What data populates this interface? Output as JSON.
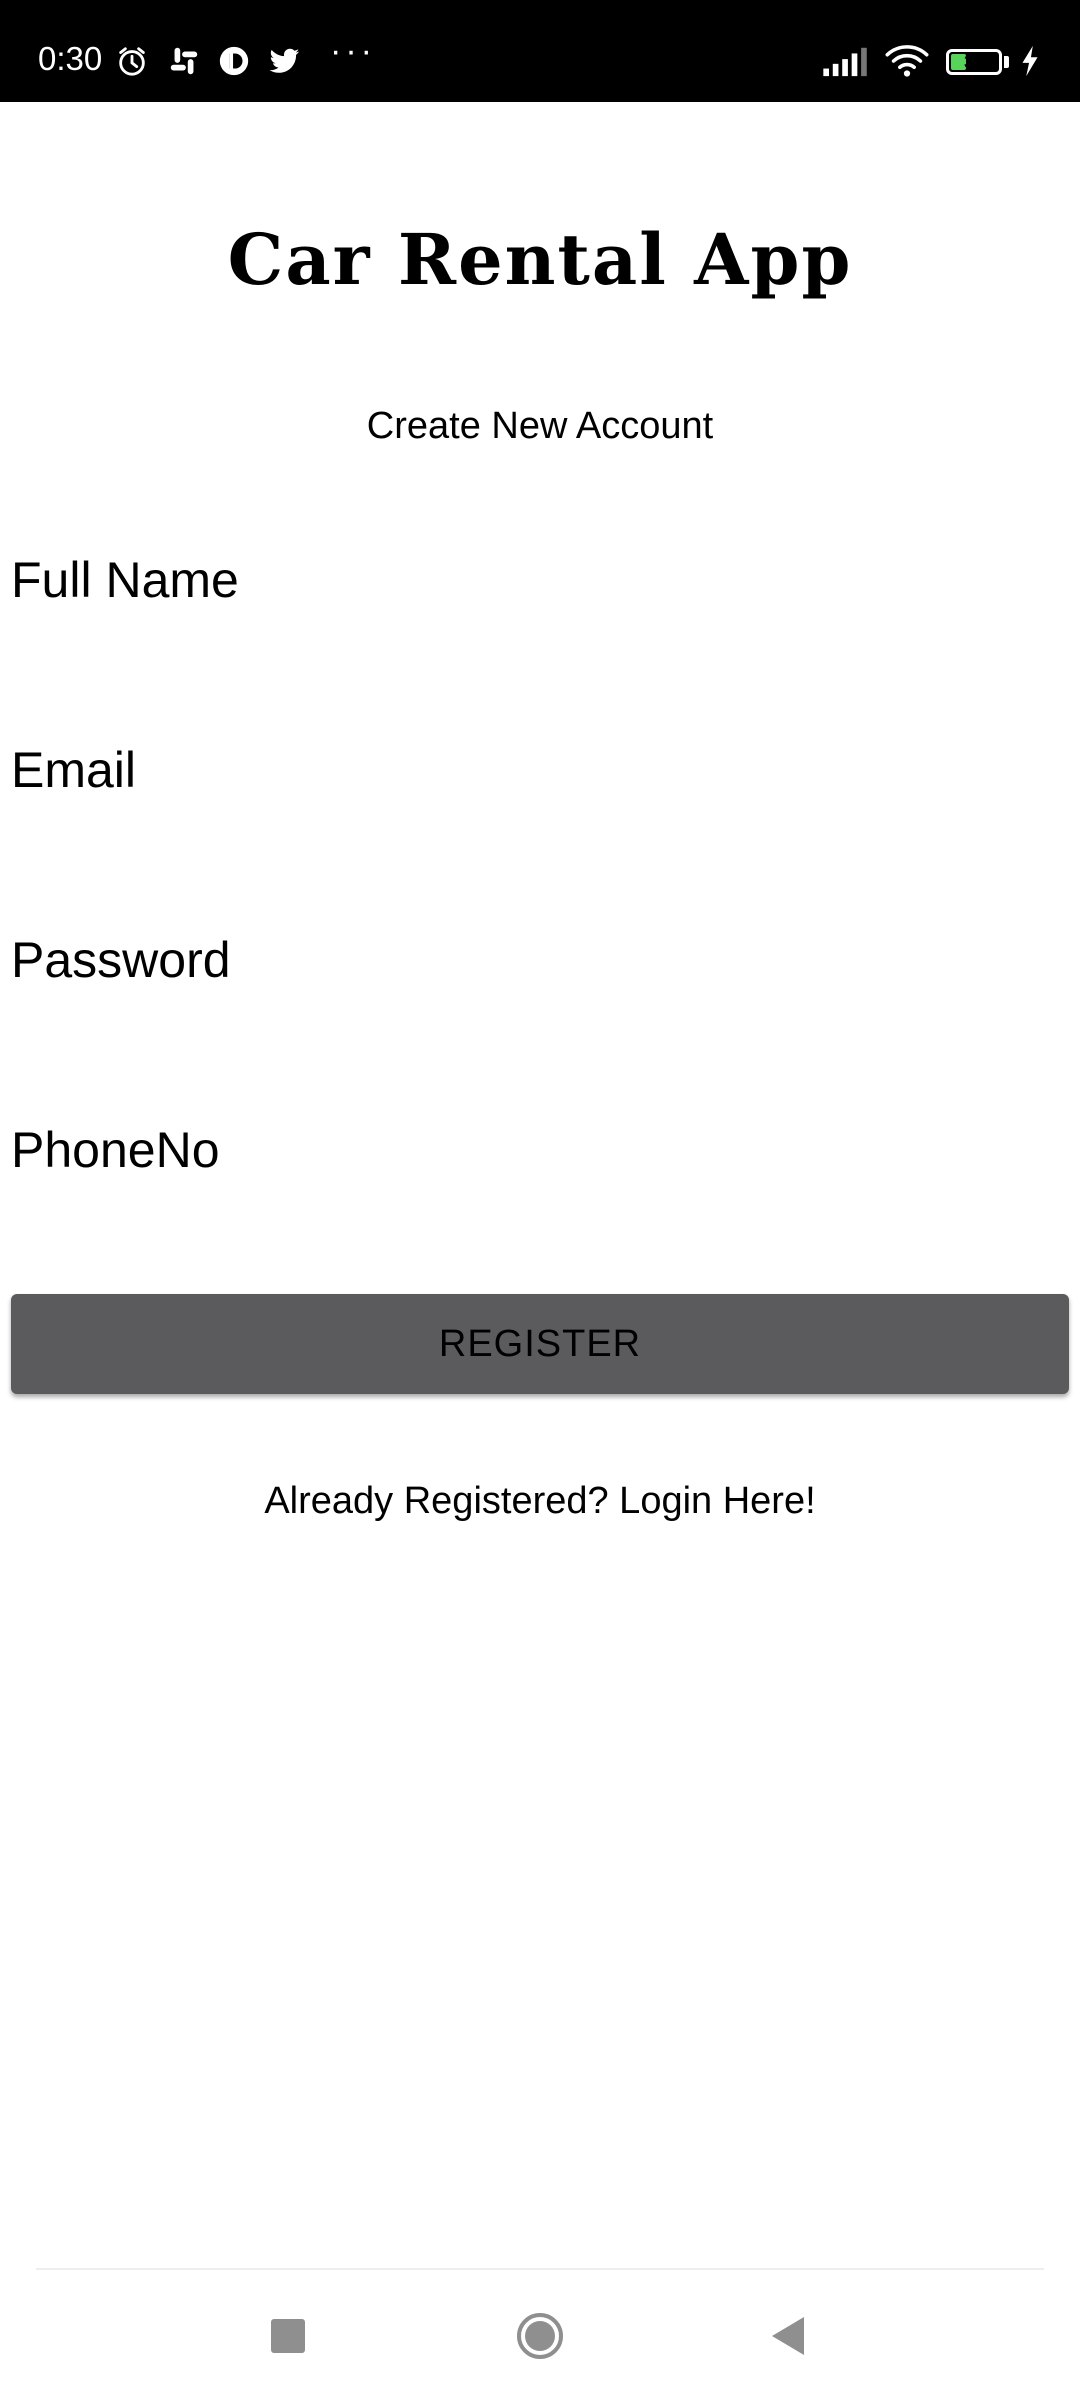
{
  "status_bar": {
    "time": "0:30",
    "icons": [
      "alarm-icon",
      "slack-icon",
      "app-icon",
      "twitter-icon"
    ],
    "more": "···",
    "battery_level": "33",
    "battery_color": "#59d45a"
  },
  "app": {
    "title": "Car Rental App",
    "subtitle": "Create New Account"
  },
  "form": {
    "full_name_placeholder": "Full Name",
    "email_placeholder": "Email",
    "password_placeholder": "Password",
    "phone_placeholder": "PhoneNo",
    "register_label": "REGISTER"
  },
  "login_link": "Already Registered? Login Here!",
  "colors": {
    "button": "#5b5b5d",
    "status_bar": "#000000",
    "nav_icon": "#8f8f8f"
  }
}
